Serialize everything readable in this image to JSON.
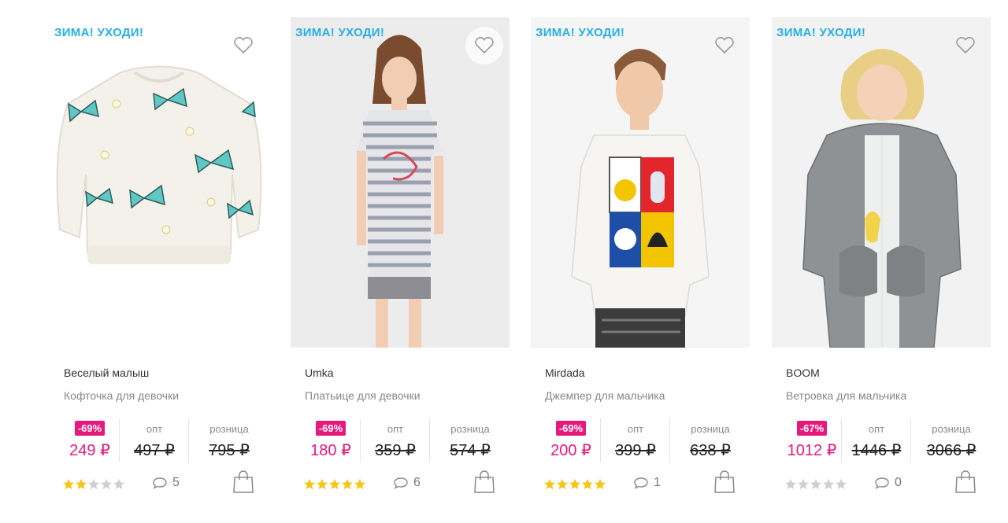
{
  "colors": {
    "promo": "#27aee3",
    "discount": "#e6197d",
    "star_on": "#f5c518",
    "star_off": "#cfcfcf"
  },
  "labels": {
    "opt": "опт",
    "retail": "розница"
  },
  "products": [
    {
      "promo": "ЗИМА! УХОДИ!",
      "brand": "Веселый малыш",
      "desc": "Кофточка для девочки",
      "discount": "-69%",
      "price": "249 ₽",
      "opt_price": "497 ₽",
      "retail_price": "795 ₽",
      "rating": 2,
      "comments": "5",
      "image": "white quilted sweater with blue butterflies"
    },
    {
      "promo": "ЗИМА! УХОДИ!",
      "brand": "Umka",
      "desc": "Платьице для девочки",
      "discount": "-69%",
      "price": "180 ₽",
      "opt_price": "359 ₽",
      "retail_price": "574 ₽",
      "rating": 5,
      "comments": "6",
      "image": "girl in grey striped dress"
    },
    {
      "promo": "ЗИМА! УХОДИ!",
      "brand": "Mirdada",
      "desc": "Джемпер для мальчика",
      "discount": "-69%",
      "price": "200 ₽",
      "opt_price": "399 ₽",
      "retail_price": "638 ₽",
      "rating": 5,
      "comments": "1",
      "image": "boy in white jumper with robot print"
    },
    {
      "promo": "ЗИМА! УХОДИ!",
      "brand": "BOOM",
      "desc": "Ветровка для мальчика",
      "discount": "-67%",
      "price": "1012 ₽",
      "opt_price": "1446 ₽",
      "retail_price": "3066 ₽",
      "rating": 0,
      "comments": "0",
      "image": "boy in grey hooded windbreaker"
    }
  ]
}
